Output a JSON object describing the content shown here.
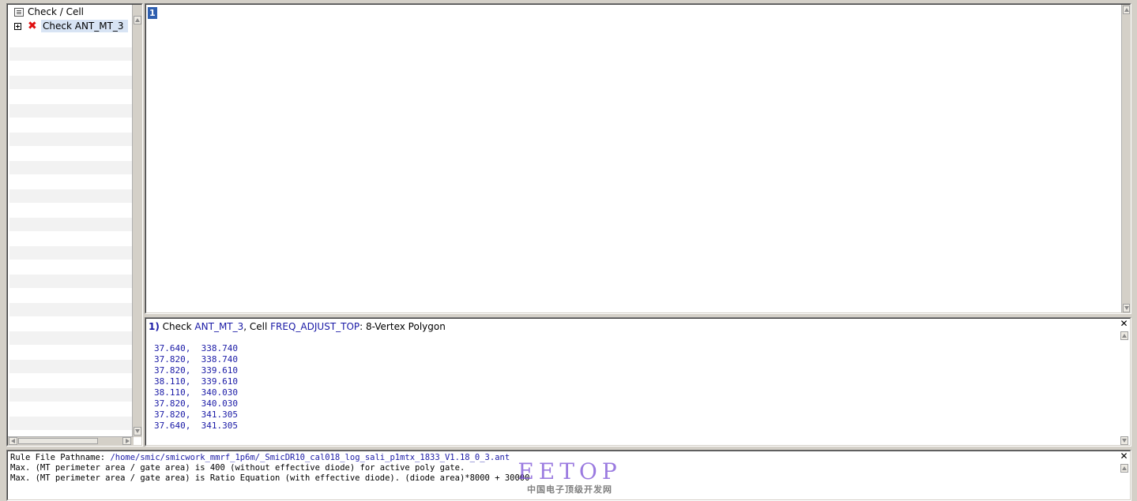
{
  "tree": {
    "header": "Check / Cell",
    "items": [
      {
        "label": "Check ANT_MT_3",
        "status_icon": "error-x-icon"
      }
    ]
  },
  "results": {
    "selected_index": "1"
  },
  "detail": {
    "index": "1)",
    "check_word": "Check",
    "check_name": "ANT_MT_3",
    "cell_word": ", Cell",
    "cell_name": "FREQ_ADJUST_TOP",
    "shape_desc": ": 8-Vertex Polygon",
    "coordinates": [
      "37.640,  338.740",
      "37.820,  338.740",
      "37.820,  339.610",
      "38.110,  339.610",
      "38.110,  340.030",
      "37.820,  340.030",
      "37.820,  341.305",
      "37.640,  341.305"
    ],
    "close_glyph": "✕"
  },
  "rule": {
    "path_label": "Rule File Pathname: ",
    "path": "/home/smic/smicwork_mmrf_1p6m/_SmicDR10_cal018_log_sali_p1mtx_1833_V1.18_0_3.ant",
    "line1": "Max. (MT perimeter area / gate area) is 400 (without effective diode) for active poly gate.",
    "line2": "Max. (MT perimeter area / gate area) is Ratio Equation (with effective diode). (diode area)*8000 + 30000",
    "close_glyph": "✕"
  },
  "watermark": {
    "logo": "EETOP",
    "subtitle": "中国电子顶级开发网"
  },
  "colors": {
    "link_blue": "#1a1aa6",
    "selection_blue": "#2f5faf",
    "error_red": "#e01010",
    "watermark_purple": "#7a4fd6"
  }
}
